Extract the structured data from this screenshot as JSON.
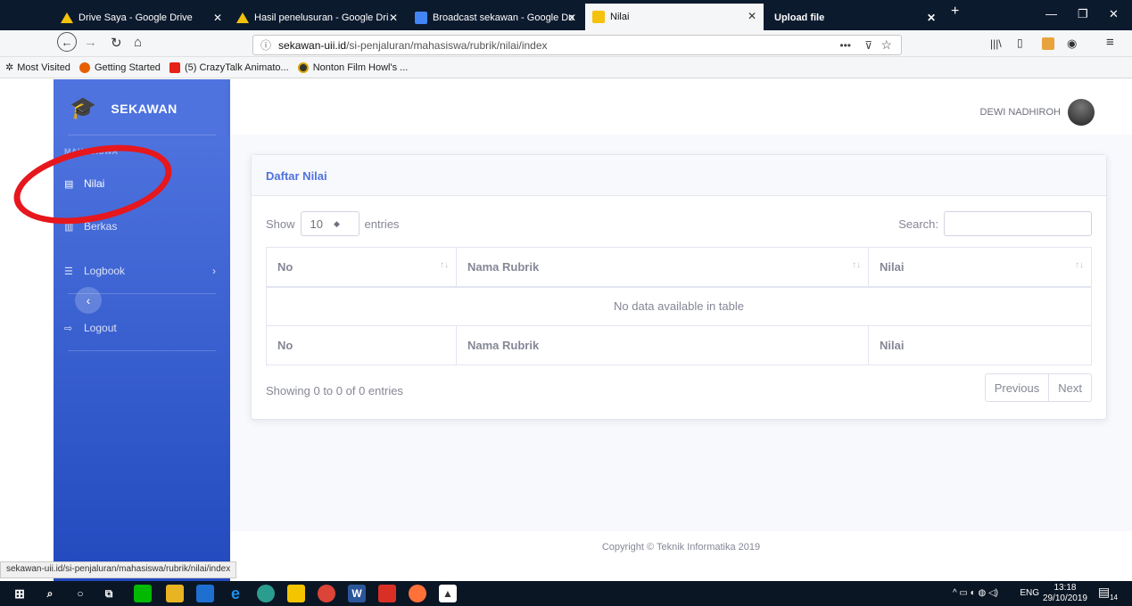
{
  "browser": {
    "tabs": [
      {
        "title": "Drive Saya - Google Drive",
        "icon": "google-drive-icon",
        "active": false
      },
      {
        "title": "Hasil penelusuran - Google Dri",
        "icon": "google-drive-icon",
        "active": false
      },
      {
        "title": "Broadcast sekawan - Google Do",
        "icon": "google-docs-icon",
        "active": false
      },
      {
        "title": "Nilai",
        "icon": "sekawan-icon",
        "active": true
      },
      {
        "title": "Upload file",
        "icon": "",
        "active": false
      }
    ],
    "url_host": "sekawan-uii.id",
    "url_path": "/si-penjaluran/mahasiswa/rubrik/nilai/index",
    "bookmarks": [
      "Most Visited",
      "Getting Started",
      "(5) CrazyTalk Animato...",
      "Nonton Film Howl's ..."
    ],
    "status_url": "sekawan-uii.id/si-penjaluran/mahasiswa/rubrik/nilai/index"
  },
  "sidebar": {
    "brand": "SEKAWAN",
    "heading": "MAHASISWA",
    "items": [
      {
        "label": "Nilai",
        "icon": "document-icon"
      },
      {
        "label": "Berkas",
        "icon": "files-icon"
      },
      {
        "label": "Logbook",
        "icon": "list-icon"
      },
      {
        "label": "Logout",
        "icon": "logout-icon"
      }
    ]
  },
  "topbar": {
    "user_name": "DEWI NADHIROH"
  },
  "card": {
    "title": "Daftar Nilai",
    "show_label": "Show",
    "entries_value": "10",
    "entries_label": "entries",
    "search_label": "Search:",
    "columns": [
      "No",
      "Nama Rubrik",
      "Nilai"
    ],
    "empty_message": "No data available in table",
    "info": "Showing 0 to 0 of 0 entries",
    "prev": "Previous",
    "next": "Next"
  },
  "footer": {
    "copyright": "Copyright © Teknik Informatika 2019"
  },
  "taskbar": {
    "lang": "ENG",
    "time": "13:18",
    "date": "29/10/2019",
    "notifications": "14"
  },
  "colors": {
    "sidebar_top": "#4e73df",
    "sidebar_bottom": "#224abe",
    "annotation": "#e6171d"
  }
}
